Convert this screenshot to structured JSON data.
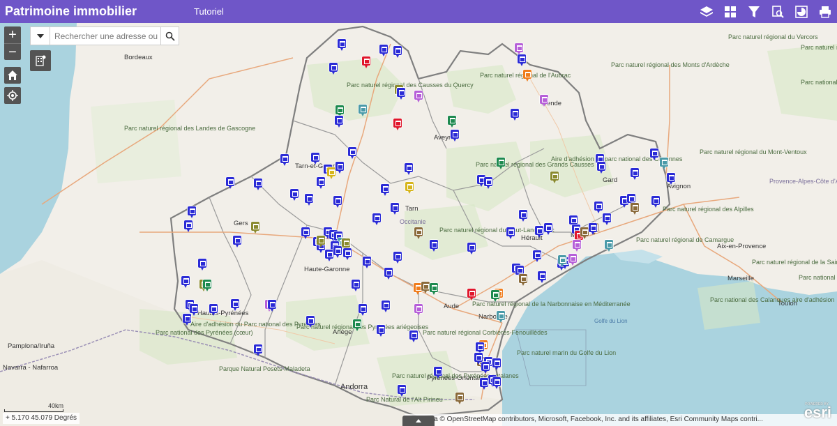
{
  "header": {
    "title": "Patrimoine immobilier",
    "tutorial_link": "Tutoriel",
    "tools": [
      {
        "name": "layers-icon"
      },
      {
        "name": "grid-icon"
      },
      {
        "name": "filter-icon"
      },
      {
        "name": "query-icon"
      },
      {
        "name": "chart-icon"
      },
      {
        "name": "print-icon"
      }
    ]
  },
  "search": {
    "placeholder": "Rechercher une adresse ou"
  },
  "controls": {
    "zoom_in": "+",
    "zoom_out": "−"
  },
  "map_labels": {
    "cities": [
      "Bordeaux",
      "Aveyron",
      "Tarn-et-Garonne",
      "Gers",
      "Tarn",
      "Hérault",
      "Gard",
      "Avignon",
      "Aix-en-Provence",
      "Marseille",
      "Toulon",
      "Haute-Garonne",
      "Aude",
      "Hautes-Pyrénées",
      "Ariège",
      "Pyrénées-Orientales",
      "Pamplona/Iruña",
      "Navarra - Nafarroa",
      "Andorra",
      "Occitanie",
      "Narbonne",
      "Mende",
      "Mi"
    ],
    "parks": [
      "Parc naturel régional des Causses du Quercy",
      "Parc naturel régional de l'Aubrac",
      "Parc naturel régional des Monts d'Ardèche",
      "Parc naturel régional du Vercors",
      "Parc naturel régional des Écrins (cœur)",
      "Parc national des Écrins",
      "Parc naturel régional des Landes de Gascogne",
      "Parc naturel régional des Grands Causses",
      "Aire d'adhésion du parc national des Cévennes",
      "Parc naturel régional du Mont-Ventoux",
      "Provence-Alpes-Côte d'Azur",
      "Parc naturel régional des Alpilles",
      "Parc naturel régional de Camargue",
      "Parc naturel régional du Haut-Languedoc",
      "Parc naturel régional de la Sainte-Baume",
      "Parc national de Port-Cros (cœur)",
      "Parc national des Calanques aire d'adhésion",
      "Parc naturel régional de la Narbonnaise en Méditerranée",
      "Parc naturel régional des Pyrénées ariégeoises",
      "Parc naturel régional Corbières-Fenouillèdes",
      "Parc naturel marin du Golfe du Lion",
      "Parc naturel régional des Pyrénées catalanes",
      "Parc national des Pyrénées (cœur)",
      "Aire d'adhésion du Parc national des Pyrénées",
      "Parque Natural Posets-Maladeta",
      "Parc Natural de l'Alt Pirineu",
      "Golfe du Lion"
    ]
  },
  "marker_colors": {
    "main": "#2b2bd6",
    "red": "#e0162b",
    "orange": "#f07c1b",
    "purple": "#b65fd8",
    "green": "#1d8a4f",
    "olive": "#8a8a2e",
    "teal": "#4a9aa8",
    "yellow": "#d6b51b",
    "brown": "#8a6a3a"
  },
  "footer": {
    "scale_label": "40km",
    "coordinates": "5.170 45.079 Degrés",
    "attribution": "Map data © OpenStreetMap contributors, Microsoft, Facebook, Inc. and its affiliates, Esri Community Maps contri...",
    "esri_powered": "POWERED BY",
    "esri_logo": "esri"
  }
}
